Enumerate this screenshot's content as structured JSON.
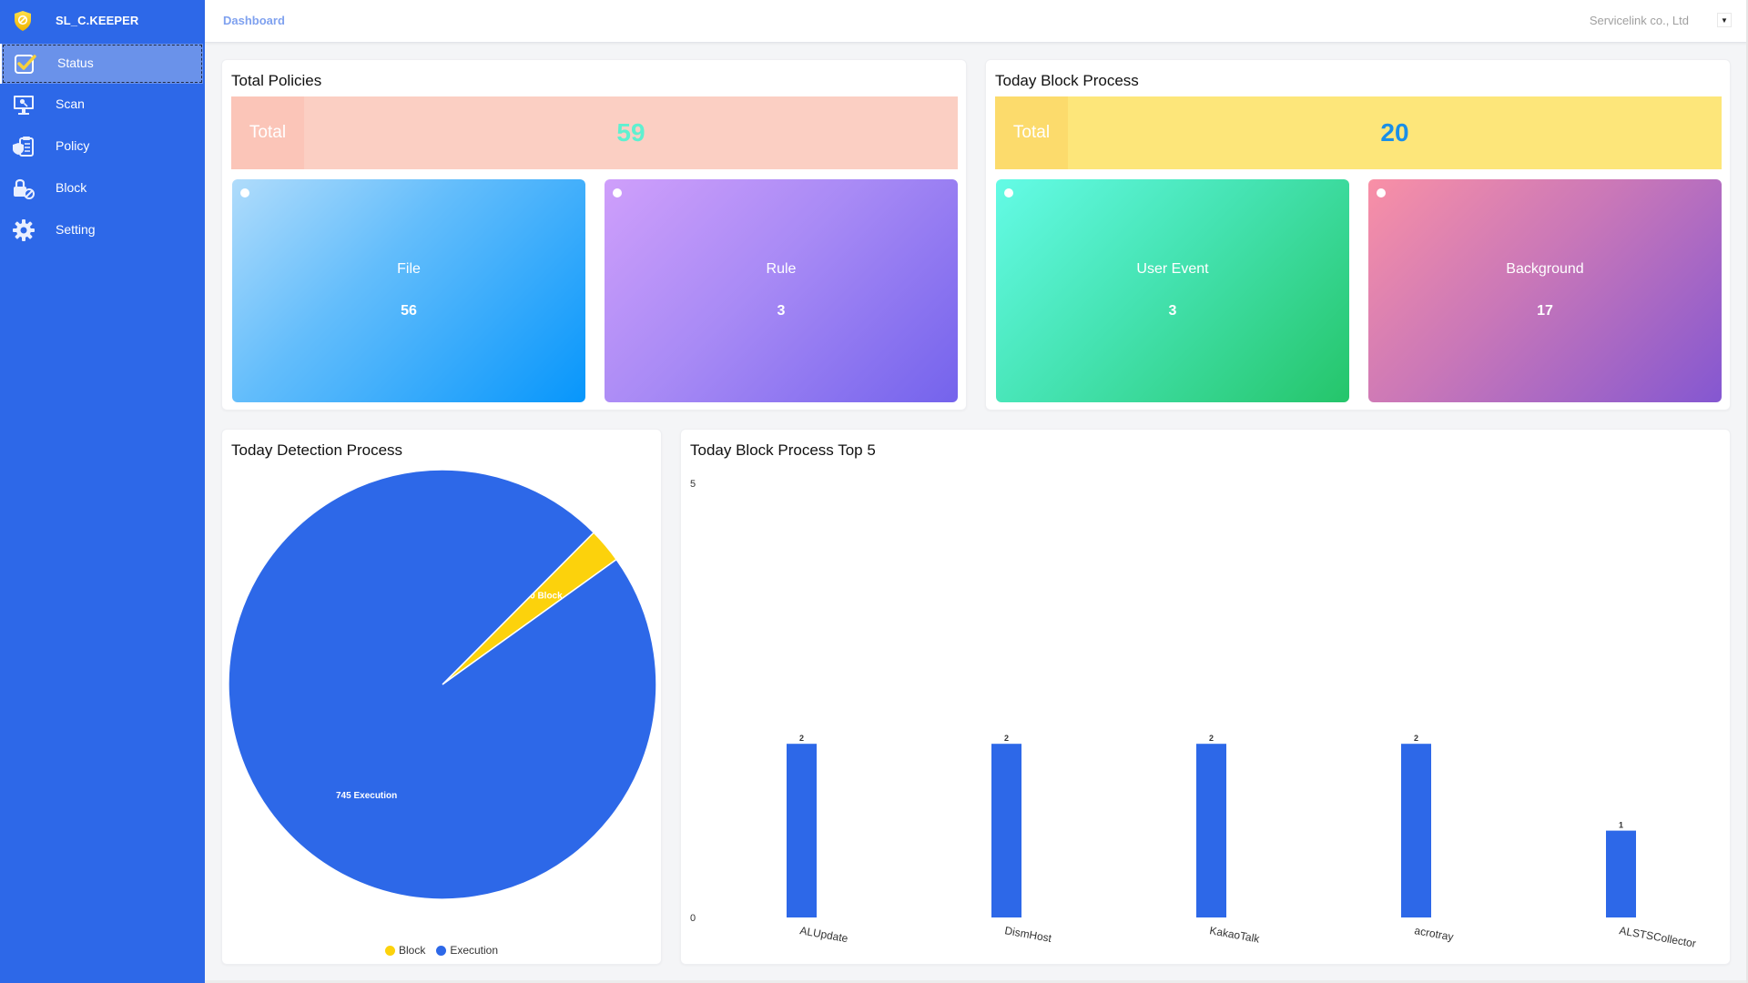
{
  "app": {
    "title": "SL_C.KEEPER",
    "logo_icon": "shield-block-icon"
  },
  "sidebar": {
    "items": [
      {
        "label": "Status",
        "icon": "check-square-icon",
        "active": true
      },
      {
        "label": "Scan",
        "icon": "monitor-search-icon",
        "active": false
      },
      {
        "label": "Policy",
        "icon": "clipboard-shield-icon",
        "active": false
      },
      {
        "label": "Block",
        "icon": "lock-block-icon",
        "active": false
      },
      {
        "label": "Setting",
        "icon": "gear-icon",
        "active": false
      }
    ]
  },
  "header": {
    "breadcrumb": "Dashboard",
    "company": "Servicelink co., Ltd",
    "dropdown_icon": "caret-down-icon"
  },
  "total_policies": {
    "title": "Total Policies",
    "total_label": "Total",
    "total_value": "59",
    "cards": [
      {
        "label": "File",
        "value": "56"
      },
      {
        "label": "Rule",
        "value": "3"
      }
    ]
  },
  "today_block_process": {
    "title": "Today Block Process",
    "total_label": "Total",
    "total_value": "20",
    "cards": [
      {
        "label": "User Event",
        "value": "3"
      },
      {
        "label": "Background",
        "value": "17"
      }
    ]
  },
  "colors": {
    "sidebar": "#2d68e8",
    "policies_total_bg": "#fbcfc3",
    "policies_total_label_bg": "#fbc5b8",
    "policies_total_value": "#5ff0d0",
    "block_total_bg": "#fde67a",
    "block_total_label_bg": "#fcdb6c",
    "block_total_value": "#1a8fe8",
    "execution": "#2d68e8",
    "block": "#fcd20c",
    "bar": "#2d68e8"
  },
  "chart_data": [
    {
      "type": "pie",
      "title": "Today Detection Process",
      "slices": [
        {
          "label": "Block",
          "value": 20,
          "data_label": "20 Block",
          "color": "#fcd20c"
        },
        {
          "label": "Execution",
          "value": 745,
          "data_label": "745 Execution",
          "color": "#2d68e8"
        }
      ],
      "legend": [
        "Block",
        "Execution"
      ],
      "legend_position": "bottom"
    },
    {
      "type": "bar",
      "title": "Today Block Process Top 5",
      "categories": [
        "ALUpdate",
        "DismHost",
        "KakaoTalk",
        "acrotray",
        "ALSTSCollector"
      ],
      "values": [
        2,
        2,
        2,
        2,
        1
      ],
      "data_labels": [
        "2",
        "2",
        "2",
        "2",
        "1"
      ],
      "yticks": [
        "0",
        "5"
      ],
      "ylim": [
        0,
        5
      ],
      "xlabel": "",
      "ylabel": "",
      "grid": false,
      "color": "#2d68e8"
    }
  ]
}
